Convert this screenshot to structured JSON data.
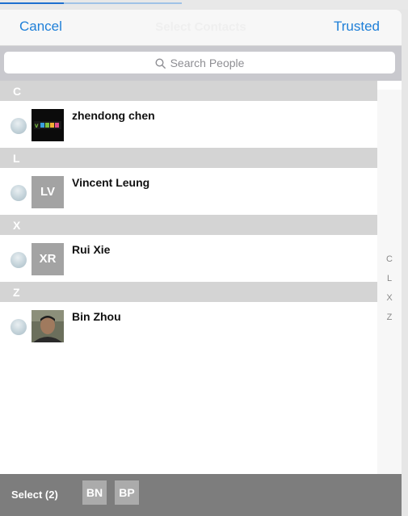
{
  "progress": {
    "fraction": 0.35,
    "color": "#1e6fcf"
  },
  "navbar": {
    "cancel": "Cancel",
    "title": "Select Contacts",
    "trusted": "Trusted"
  },
  "search": {
    "placeholder": "Search People"
  },
  "sections": [
    {
      "letter": "C",
      "contacts": [
        {
          "name": "zhendong chen",
          "initials": "",
          "avatar": "vmoso-logo"
        }
      ]
    },
    {
      "letter": "L",
      "contacts": [
        {
          "name": "Vincent Leung",
          "initials": "LV",
          "avatar": "initials"
        }
      ]
    },
    {
      "letter": "X",
      "contacts": [
        {
          "name": "Rui Xie",
          "initials": "XR",
          "avatar": "initials"
        }
      ]
    },
    {
      "letter": "Z",
      "contacts": [
        {
          "name": "Bin Zhou",
          "initials": "",
          "avatar": "photo"
        }
      ]
    }
  ],
  "index": [
    "C",
    "L",
    "X",
    "Z"
  ],
  "bottom": {
    "select_label": "Select (2)",
    "chips": [
      "BN",
      "BP"
    ]
  }
}
